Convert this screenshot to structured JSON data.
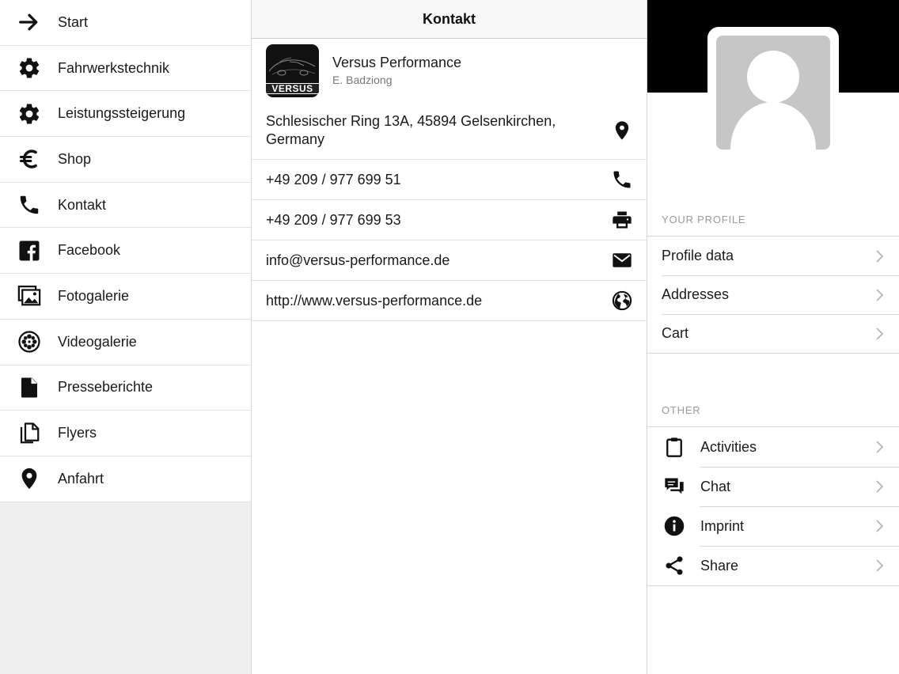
{
  "nav": {
    "items": [
      {
        "label": "Start",
        "icon": "arrow-right-icon"
      },
      {
        "label": "Fahrwerkstechnik",
        "icon": "gear-icon"
      },
      {
        "label": "Leistungssteigerung",
        "icon": "gear-icon"
      },
      {
        "label": "Shop",
        "icon": "euro-icon"
      },
      {
        "label": "Kontakt",
        "icon": "phone-icon"
      },
      {
        "label": "Facebook",
        "icon": "facebook-icon"
      },
      {
        "label": "Fotogalerie",
        "icon": "photo-gallery-icon"
      },
      {
        "label": "Videogalerie",
        "icon": "film-reel-icon"
      },
      {
        "label": "Presseberichte",
        "icon": "document-icon"
      },
      {
        "label": "Flyers",
        "icon": "documents-copy-icon"
      },
      {
        "label": "Anfahrt",
        "icon": "location-pin-icon"
      }
    ]
  },
  "contact": {
    "title": "Kontakt",
    "company": {
      "name": "Versus Performance",
      "person": "E. Badziong",
      "logo_text": "VERSUS"
    },
    "address": "Schlesischer Ring 13A, 45894 Gelsenkirchen, Germany",
    "phone": "+49 209 / 977 699 51",
    "fax": "+49 209 / 977 699 53",
    "email": "info@versus-performance.de",
    "website": "http://www.versus-performance.de"
  },
  "profile": {
    "section_profile_label": "YOUR PROFILE",
    "profile_items": [
      {
        "label": "Profile data"
      },
      {
        "label": "Addresses"
      },
      {
        "label": "Cart"
      }
    ],
    "section_other_label": "OTHER",
    "other_items": [
      {
        "label": "Activities",
        "icon": "clipboard-icon"
      },
      {
        "label": "Chat",
        "icon": "chat-bubbles-icon"
      },
      {
        "label": "Imprint",
        "icon": "info-icon"
      },
      {
        "label": "Share",
        "icon": "share-icon"
      }
    ]
  },
  "colors": {
    "banner": "#000000",
    "avatar_placeholder": "#c6c6c6",
    "section_label": "#9a9a9a",
    "divider": "#d6d6d6"
  }
}
